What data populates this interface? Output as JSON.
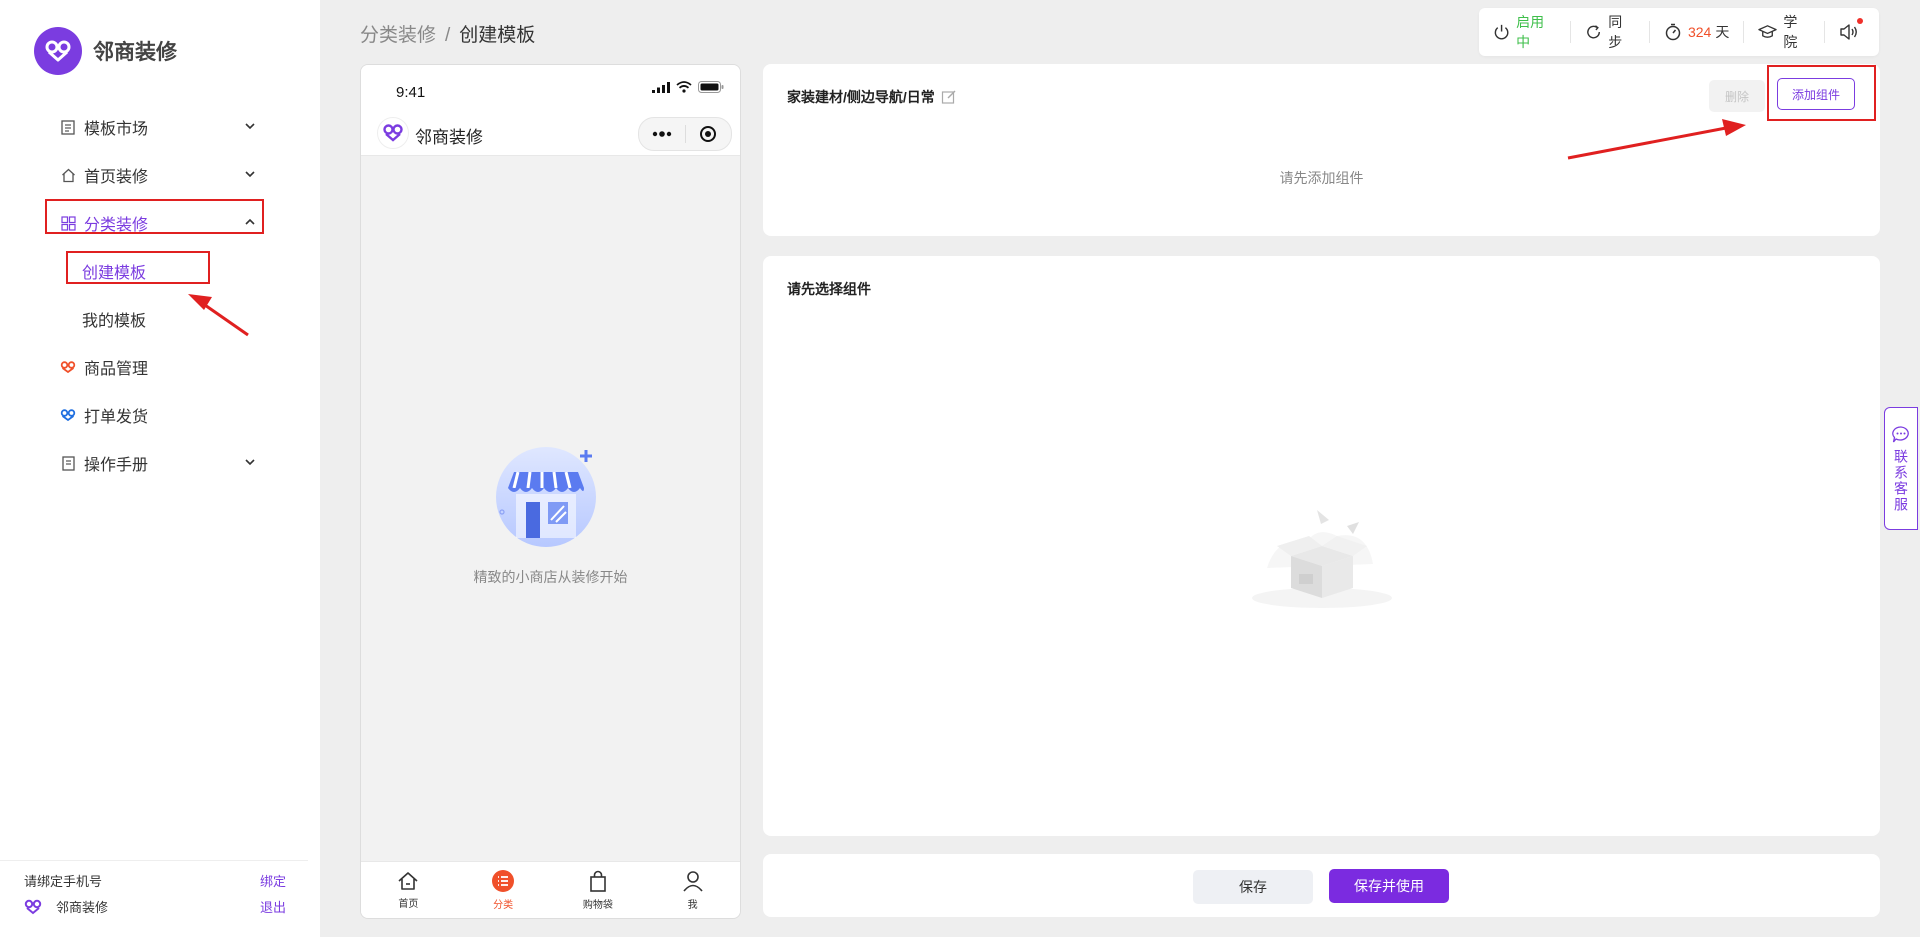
{
  "brand": {
    "name": "邻商装修"
  },
  "sidebar": {
    "items": [
      {
        "label": "模板市场"
      },
      {
        "label": "首页装修"
      },
      {
        "label": "分类装修"
      },
      {
        "label": "创建模板"
      },
      {
        "label": "我的模板"
      },
      {
        "label": "商品管理"
      },
      {
        "label": "打单发货"
      },
      {
        "label": "操作手册"
      }
    ],
    "footer": {
      "bind_prompt": "请绑定手机号",
      "bind_link": "绑定",
      "shop_name": "邻商装修",
      "logout_link": "退出"
    }
  },
  "breadcrumb": {
    "parent": "分类装修",
    "separator": "/",
    "current": "创建模板"
  },
  "topbar": {
    "status": "启用中",
    "sync": "同步",
    "days_value": "324",
    "days_unit": "天",
    "academy": "学院"
  },
  "phone": {
    "time": "9:41",
    "title": "邻商装修",
    "empty_text": "精致的小商店从装修开始",
    "tabs": [
      {
        "label": "首页"
      },
      {
        "label": "分类"
      },
      {
        "label": "购物袋"
      },
      {
        "label": "我"
      }
    ]
  },
  "editor": {
    "template_title": "家装建材/侧边导航/日常",
    "delete_label": "删除",
    "add_label": "添加组件",
    "empty_hint": "请先添加组件",
    "select_title": "请先选择组件",
    "save_label": "保存",
    "save_use_label": "保存并使用"
  },
  "contact": {
    "label": "联系客服"
  },
  "colors": {
    "brand": "#7b3ce0",
    "active_tab": "#f0502a",
    "status_green": "#3fbf4b",
    "annotation_red": "#e02020"
  }
}
